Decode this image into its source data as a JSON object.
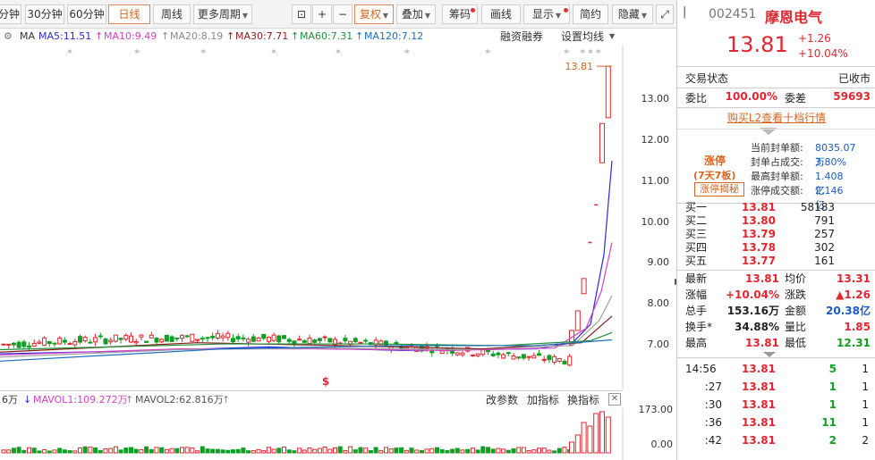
{
  "toolbar": {
    "items": [
      {
        "label": "分钟"
      },
      {
        "label": "30分钟"
      },
      {
        "label": "60分钟"
      },
      {
        "label": "日线",
        "active": true
      },
      {
        "label": "周线"
      },
      {
        "label": "更多周期"
      },
      {
        "label": "复权",
        "active": true
      },
      {
        "label": "叠加"
      },
      {
        "label": "筹码"
      },
      {
        "label": "画线"
      },
      {
        "label": "显示"
      },
      {
        "label": "简约"
      },
      {
        "label": "隐藏"
      }
    ]
  },
  "ma_legend": {
    "ma": "MA",
    "ma5": "MA5:11.51",
    "ma10": "MA10:9.49",
    "ma20": "MA20:8.19",
    "ma30": "MA30:7.71",
    "ma60": "MA60:7.31",
    "ma120": "MA120:7.12",
    "margin": "融资融券",
    "settings": "设置均线"
  },
  "price_axis": {
    "ticks": [
      "13.00",
      "12.00",
      "11.00",
      "10.00",
      "9.00",
      "8.00",
      "7.00"
    ],
    "last_price_label": "13.81"
  },
  "volume_panel": {
    "vol_prefix": "6万",
    "mavol1": "MAVOL1:109.272万",
    "mavol2": "MAVOL2:62.816万",
    "change_params": "改参数",
    "add_indicator": "加指标",
    "switch_indicator": "换指标",
    "axis_top": "173.00",
    "axis_bottom": "0.00"
  },
  "stock": {
    "code": "002451",
    "name": "摩恩电气",
    "price": "13.81",
    "change": "+1.26",
    "change_pct": "+10.04%"
  },
  "trade_status": {
    "label": "交易状态",
    "value": "已收市"
  },
  "wei": {
    "ratio_label": "委比",
    "ratio_value": "100.00%",
    "diff_label": "委差",
    "diff_value": "59693"
  },
  "l2_link": "购买L2查看十档行情",
  "limit_up": {
    "badge": "涨停",
    "streak": "(7天7板)",
    "reveal_button": "涨停揭秘",
    "rows": [
      {
        "label": "当前封单额:",
        "value": "8035.07万"
      },
      {
        "label": "封单占成交:",
        "value": "3.80%"
      },
      {
        "label": "最高封单额:",
        "value": "1.408亿"
      },
      {
        "label": "涨停成交额:",
        "value": "2.146亿"
      }
    ]
  },
  "bids": [
    {
      "label": "买一",
      "price": "13.81",
      "volume": "58183"
    },
    {
      "label": "买二",
      "price": "13.80",
      "volume": "791"
    },
    {
      "label": "买三",
      "price": "13.79",
      "volume": "257"
    },
    {
      "label": "买四",
      "price": "13.78",
      "volume": "302"
    },
    {
      "label": "买五",
      "price": "13.77",
      "volume": "161"
    }
  ],
  "quote": [
    {
      "l1": "最新",
      "v1": "13.81",
      "l2": "均价",
      "v2": "13.31"
    },
    {
      "l1": "涨幅",
      "v1": "+10.04%",
      "l2": "涨跌",
      "v2": "▲1.26"
    },
    {
      "l1": "总手",
      "v1": "153.16万",
      "l2": "金额",
      "v2": "20.38亿"
    },
    {
      "l1": "换手*",
      "v1": "34.88%",
      "l2": "量比",
      "v2": "1.85"
    },
    {
      "l1": "最高",
      "v1": "13.81",
      "l2": "最低",
      "v2": "12.31"
    }
  ],
  "ticks": [
    {
      "time": "14:56",
      "price": "13.81",
      "vol": "5",
      "n": "1"
    },
    {
      "time": ":27",
      "price": "13.81",
      "vol": "1",
      "n": "1"
    },
    {
      "time": ":30",
      "price": "13.81",
      "vol": "1",
      "n": "1"
    },
    {
      "time": ":36",
      "price": "13.81",
      "vol": "11",
      "n": "1"
    },
    {
      "time": ":42",
      "price": "13.81",
      "vol": "2",
      "n": "2"
    }
  ],
  "colors": {
    "up": "#e3262f",
    "down": "#129e24",
    "ma5": "#2b2bd9",
    "ma10": "#d53fc9",
    "ma20": "#a0a0a0",
    "ma30": "#8b1a1a",
    "ma60": "#1f8f3a",
    "ma120": "#1a6fbf"
  }
}
